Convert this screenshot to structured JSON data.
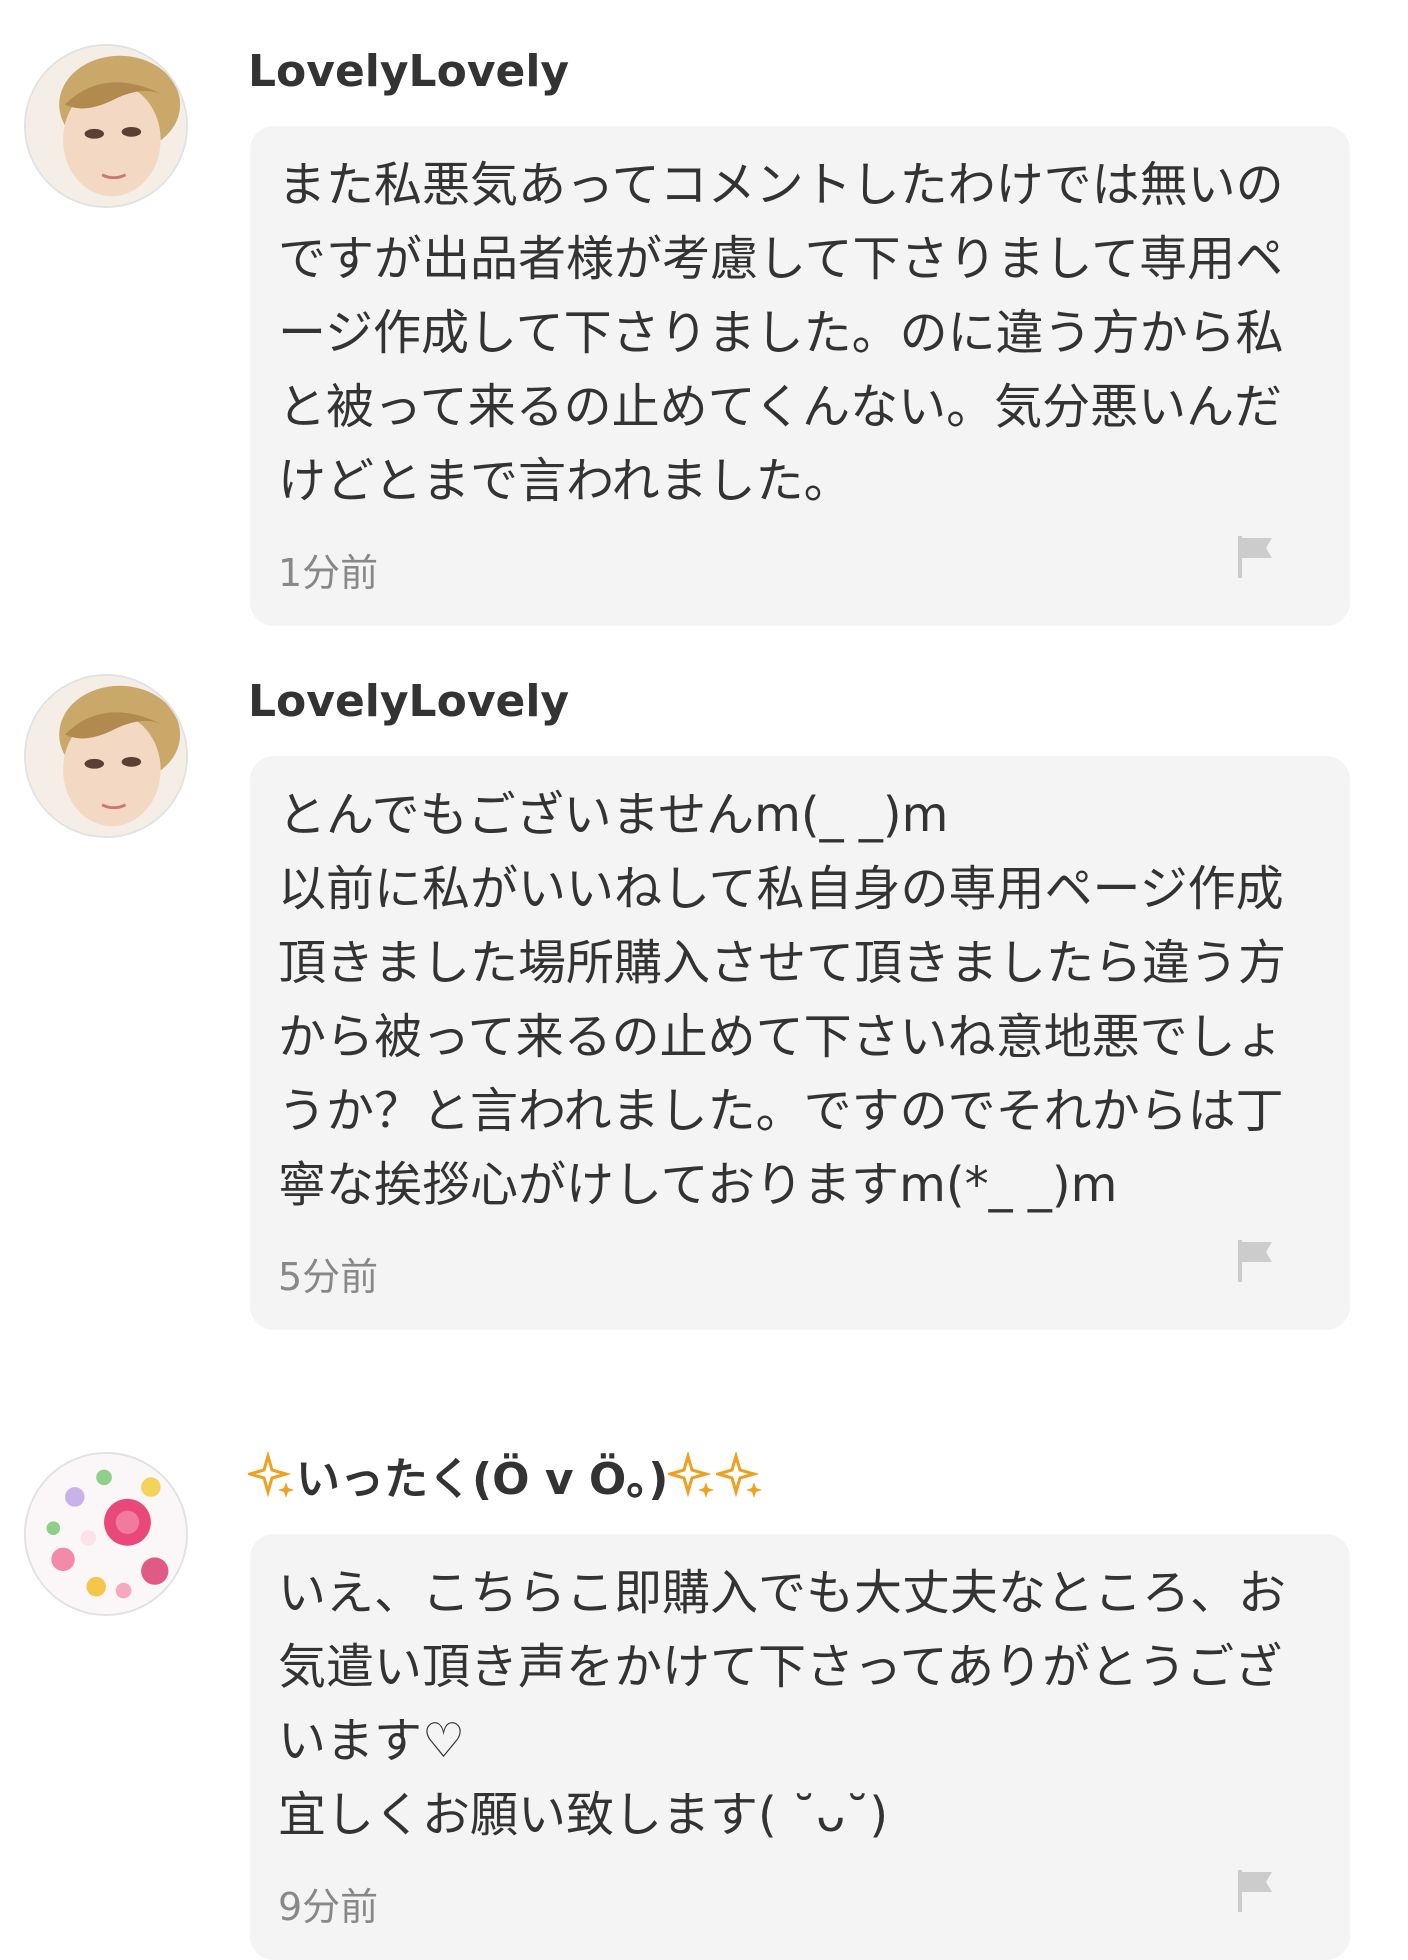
{
  "comments": [
    {
      "user": "LovelyLovely",
      "text": "また私悪気あってコメントしたわけでは無いのですが出品者様が考慮して下さりまして専用ページ作成して下さりました。のに違う方から私と被って来るの止めてくんない。気分悪いんだけどとまで言われました。",
      "time": "1分前",
      "avatar_icon": "profile-photo"
    },
    {
      "user": "LovelyLovely",
      "text": "とんでもございませんm(_ _)m\n以前に私がいいねして私自身の専用ページ作成頂きました場所購入させて頂きましたら違う方から被って来るの止めて下さいね意地悪でしょうか？と言われました。ですのでそれからは丁寧な挨拶心がけしておりますm(*_ _)m",
      "time": "5分前",
      "avatar_icon": "profile-photo"
    },
    {
      "user_prefix": "✧",
      "user": "いったく(Ö v Ö。)",
      "user_suffix": "✧ ✧",
      "text": "いえ、こちらこ即購入でも大丈夫なところ、お気遣い頂き声をかけて下さってありがとうございます♡\n宜しくお願い致します( ˘ᴗ˘)",
      "time": "9分前",
      "avatar_icon": "flowers-photo"
    }
  ],
  "colors": {
    "bubble": "#f4f4f4",
    "text": "#333333",
    "meta": "#888888",
    "flag": "#cccccc",
    "sparkle": "#f0a020"
  }
}
